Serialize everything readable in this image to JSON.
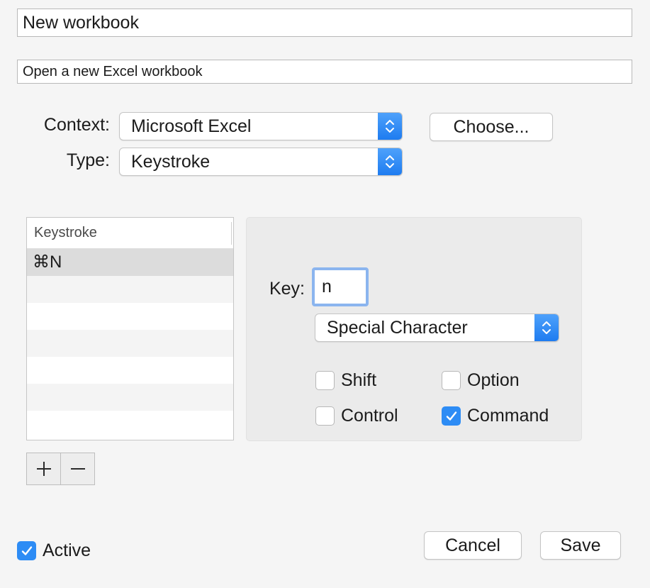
{
  "name_field": {
    "value": "New workbook"
  },
  "description_field": {
    "value": "Open a new Excel workbook"
  },
  "context": {
    "label": "Context:",
    "selected": "Microsoft Excel",
    "choose_label": "Choose..."
  },
  "type": {
    "label": "Type:",
    "selected": "Keystroke"
  },
  "keystroke_table": {
    "header": "Keystroke",
    "rows": [
      "⌘N"
    ]
  },
  "table_controls": {
    "add_symbol": "+",
    "remove_symbol": "−"
  },
  "detail": {
    "key_label": "Key:",
    "key_value": "n",
    "special_character": "Special Character",
    "modifiers": {
      "shift": {
        "label": "Shift",
        "checked": false
      },
      "option": {
        "label": "Option",
        "checked": false
      },
      "control": {
        "label": "Control",
        "checked": false
      },
      "command": {
        "label": "Command",
        "checked": true
      }
    }
  },
  "footer": {
    "active": {
      "label": "Active",
      "checked": true
    },
    "cancel_label": "Cancel",
    "save_label": "Save"
  },
  "colors": {
    "accent": "#2d8cf5",
    "window_bg": "#f5f5f5",
    "panel_bg": "#ebebeb",
    "focus_ring": "#8bb5ef"
  }
}
